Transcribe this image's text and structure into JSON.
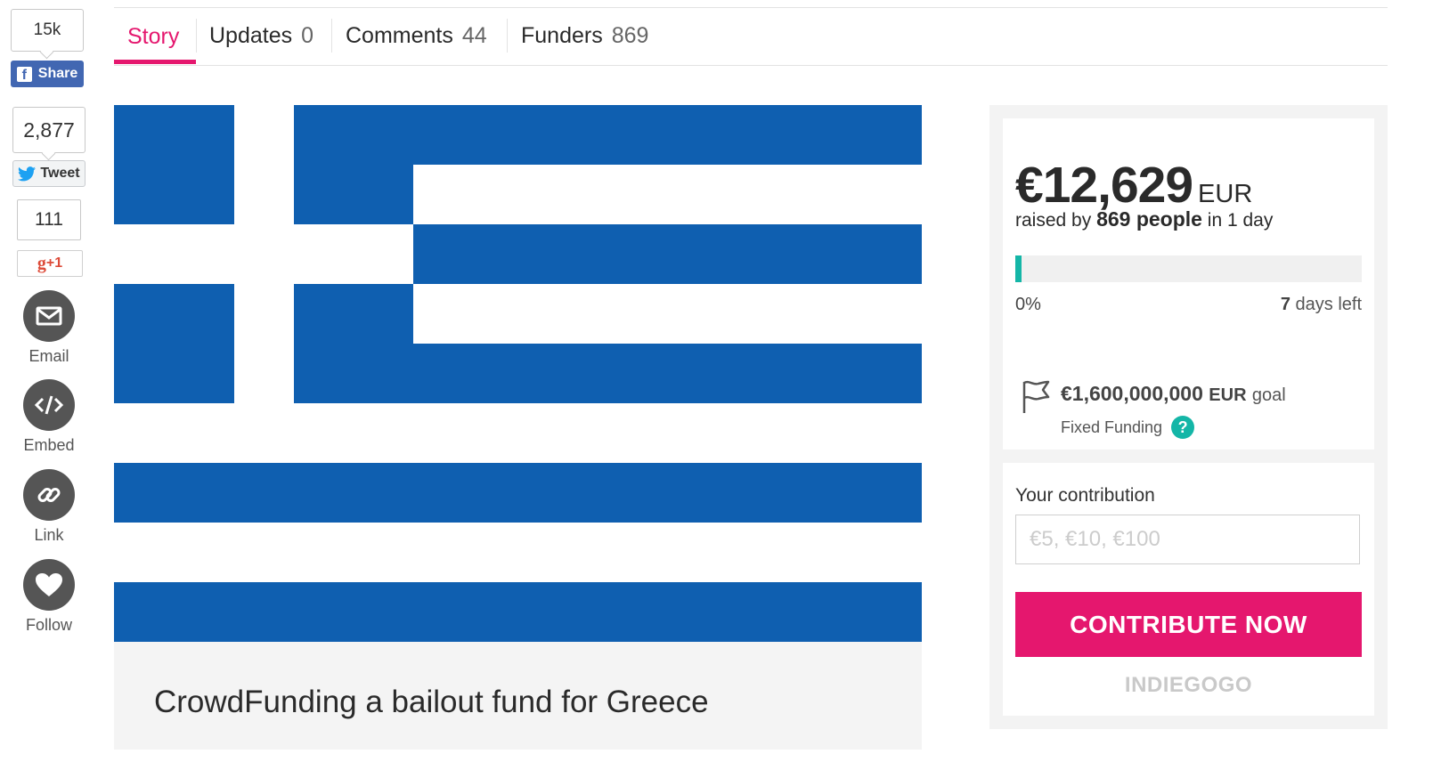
{
  "social": {
    "facebook": {
      "count": "15k",
      "share_label": "Share"
    },
    "twitter": {
      "count": "2,877",
      "tweet_label": "Tweet"
    },
    "google": {
      "count": "111",
      "plus_label": "+1"
    },
    "actions": [
      {
        "label": "Email",
        "icon": "envelope-icon"
      },
      {
        "label": "Embed",
        "icon": "code-icon"
      },
      {
        "label": "Link",
        "icon": "link-icon"
      },
      {
        "label": "Follow",
        "icon": "heart-icon"
      }
    ]
  },
  "tabs": [
    {
      "label": "Story",
      "count": "",
      "active": true
    },
    {
      "label": "Updates",
      "count": "0",
      "active": false
    },
    {
      "label": "Comments",
      "count": "44",
      "active": false
    },
    {
      "label": "Funders",
      "count": "869",
      "active": false
    }
  ],
  "hero": {
    "image": "greek-flag",
    "colors": {
      "blue": "#0f5fb0",
      "white": "#ffffff"
    }
  },
  "campaign": {
    "title": "CrowdFunding a bailout fund for Greece"
  },
  "funding": {
    "amount": "€12,629",
    "currency": "EUR",
    "raised_prefix": "raised by",
    "people": "869 people",
    "raised_suffix": "in 1 day",
    "progress_percent": 0,
    "percent_label": "0%",
    "days_left_num": "7",
    "days_left_label": "days left",
    "goal_amount": "€1,600,000,000",
    "goal_currency": "EUR",
    "goal_label": "goal",
    "funding_type": "Fixed Funding",
    "accent": "#14b6a7"
  },
  "contribution": {
    "label": "Your contribution",
    "placeholder": "€5, €10, €100",
    "button": "CONTRIBUTE NOW",
    "brand": "INDIEGOGO",
    "button_color": "#e5176e"
  }
}
